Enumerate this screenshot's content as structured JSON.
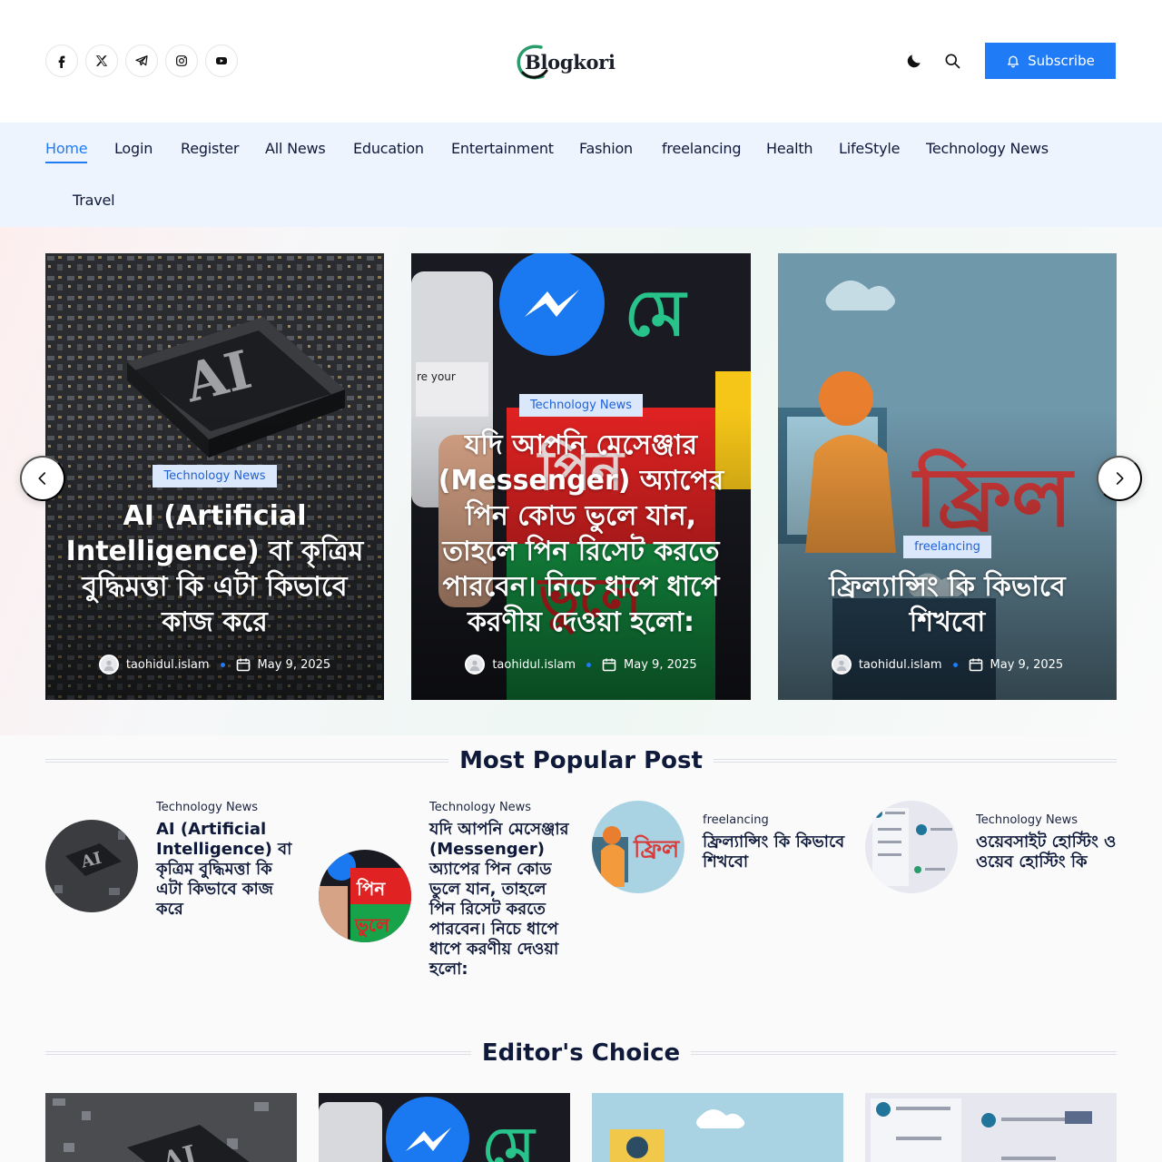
{
  "header": {
    "socials": [
      {
        "icon": "facebook-icon"
      },
      {
        "icon": "x-icon"
      },
      {
        "icon": "telegram-icon"
      },
      {
        "icon": "instagram-icon"
      },
      {
        "icon": "youtube-icon"
      }
    ],
    "logo_text": "Blogkori",
    "subscribe_label": "Subscribe",
    "accent_color": "#1f7bf6"
  },
  "nav": {
    "items": [
      "Home",
      "Login",
      "Register",
      "All News",
      "Education",
      "Entertainment",
      "Fashion",
      "freelancing",
      "Health",
      "LifeStyle",
      "Technology News",
      "Travel"
    ],
    "active": "Home"
  },
  "hero": {
    "cards": [
      {
        "category": "Technology News",
        "title": "AI (Artificial Intelligence) বা কৃত্রিম বুদ্ধিমত্তা কি এটা কিভাবে কাজ করে",
        "author": "taohidul.islam",
        "date": "May 9, 2025"
      },
      {
        "category": "Technology News",
        "title": "যদি আপনি মেসেঞ্জার (Messenger) অ্যাপের পিন কোড ভুলে যান, তাহলে পিন রিসেট করতে পারবেন। নিচে ধাপে ধাপে করণীয় দেওয়া হলো:",
        "author": "taohidul.islam",
        "date": "May 9, 2025"
      },
      {
        "category": "freelancing",
        "title": "ফ্রিল্যান্সিং কি কিভাবে শিখবো",
        "author": "taohidul.islam",
        "date": "May 9, 2025"
      }
    ]
  },
  "popular": {
    "heading": "Most Popular Post",
    "items": [
      {
        "category": "Technology News",
        "title": "AI (Artificial Intelligence) বা কৃত্রিম বুদ্ধিমত্তা কি এটা কিভাবে কাজ করে"
      },
      {
        "category": "Technology News",
        "title": "যদি আপনি মেসেঞ্জার (Messenger) অ্যাপের পিন কোড ভুলে যান, তাহলে পিন রিসেট করতে পারবেন। নিচে ধাপে ধাপে করণীয় দেওয়া হলো:"
      },
      {
        "category": "freelancing",
        "title": "ফ্রিল্যান্সিং কি কিভাবে শিখবো"
      },
      {
        "category": "Technology News",
        "title": "ওয়েবসাইট হোস্টিং ও ওয়েব হোস্টিং কি"
      }
    ]
  },
  "editors": {
    "heading": "Editor's Choice"
  }
}
